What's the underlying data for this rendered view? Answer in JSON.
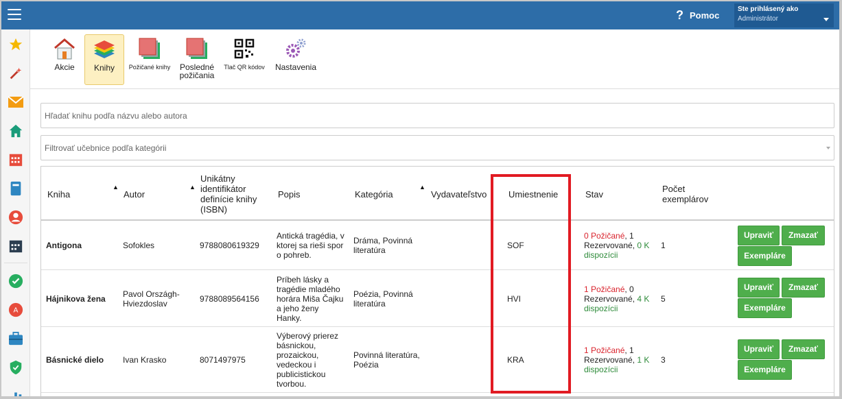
{
  "header": {
    "help_label": "Pomoc",
    "user_line1": "Ste prihlásený ako",
    "user_line2": "Administrátor"
  },
  "toolbar": {
    "items": [
      {
        "label": "Akcie"
      },
      {
        "label": "Knihy"
      },
      {
        "label": "Požičané knihy"
      },
      {
        "label1": "Posledné",
        "label2": "požičania"
      },
      {
        "label": "Tlač QR kódov"
      },
      {
        "label": "Nastavenia"
      }
    ]
  },
  "search": {
    "placeholder": "Hľadať knihu podľa názvu alebo autora"
  },
  "filter": {
    "placeholder": "Filtrovať učebnice podľa kategórii"
  },
  "table": {
    "headers": {
      "kniha": "Kniha",
      "autor": "Autor",
      "isbn1": "Unikátny",
      "isbn2": "identifikátor",
      "isbn3": "definície knihy",
      "isbn4": "(ISBN)",
      "popis": "Popis",
      "kategoria": "Kategória",
      "vydavatelstvo": "Vydavateľstvo",
      "umiestnenie": "Umiestnenie",
      "stav": "Stav",
      "pocet1": "Počet",
      "pocet2": "exemplárov",
      "sort": "▲"
    },
    "rows": [
      {
        "kniha": "Antigona",
        "autor1": "Sofokles",
        "autor2": "",
        "isbn": "9788080619329",
        "popis": [
          "Antická tragédia, v",
          "ktorej sa rieši spor",
          "o pohreb."
        ],
        "kat": [
          "Dráma, Povinná",
          "literatúra"
        ],
        "umiest": "SOF",
        "stav_red": "0 Požičané",
        "stav_mid": ", 1",
        "stav_l2": "Rezervované, ",
        "stav_green1": "0 K",
        "stav_green2": "dispozícii",
        "pocet": "1"
      },
      {
        "kniha": "Hájnikova žena",
        "autor1": "Pavol Országh-",
        "autor2": "Hviezdoslav",
        "isbn": "9788089564156",
        "popis": [
          "Príbeh lásky a",
          "tragédie mladého",
          "horára Miša Čajku",
          "a jeho ženy",
          "Hanky."
        ],
        "kat": [
          "Poézia, Povinná",
          "literatúra"
        ],
        "umiest": "HVI",
        "stav_red": "1 Požičané",
        "stav_mid": ", 0",
        "stav_l2": "Rezervované, ",
        "stav_green1": "4 K",
        "stav_green2": "dispozícii",
        "pocet": "5"
      },
      {
        "kniha": "Básnické dielo",
        "autor1": "Ivan Krasko",
        "autor2": "",
        "isbn": "8071497975",
        "popis": [
          "Výberový prierez",
          "básnickou,",
          "prozaickou,",
          "vedeckou i",
          "publicistickou",
          "tvorbou."
        ],
        "kat": [
          "Povinná literatúra,",
          "Poézia"
        ],
        "umiest": "KRA",
        "stav_red": "1 Požičané",
        "stav_mid": ", 1",
        "stav_l2": "Rezervované, ",
        "stav_green1": "1 K",
        "stav_green2": "dispozícii",
        "pocet": "3"
      }
    ],
    "buttons": {
      "edit": "Upraviť",
      "delete": "Zmazať",
      "copies": "Exempláre"
    }
  },
  "colors": {
    "topbar": "#2d6da8",
    "button_green": "#4fae4c",
    "highlight_red": "#e11a22"
  }
}
